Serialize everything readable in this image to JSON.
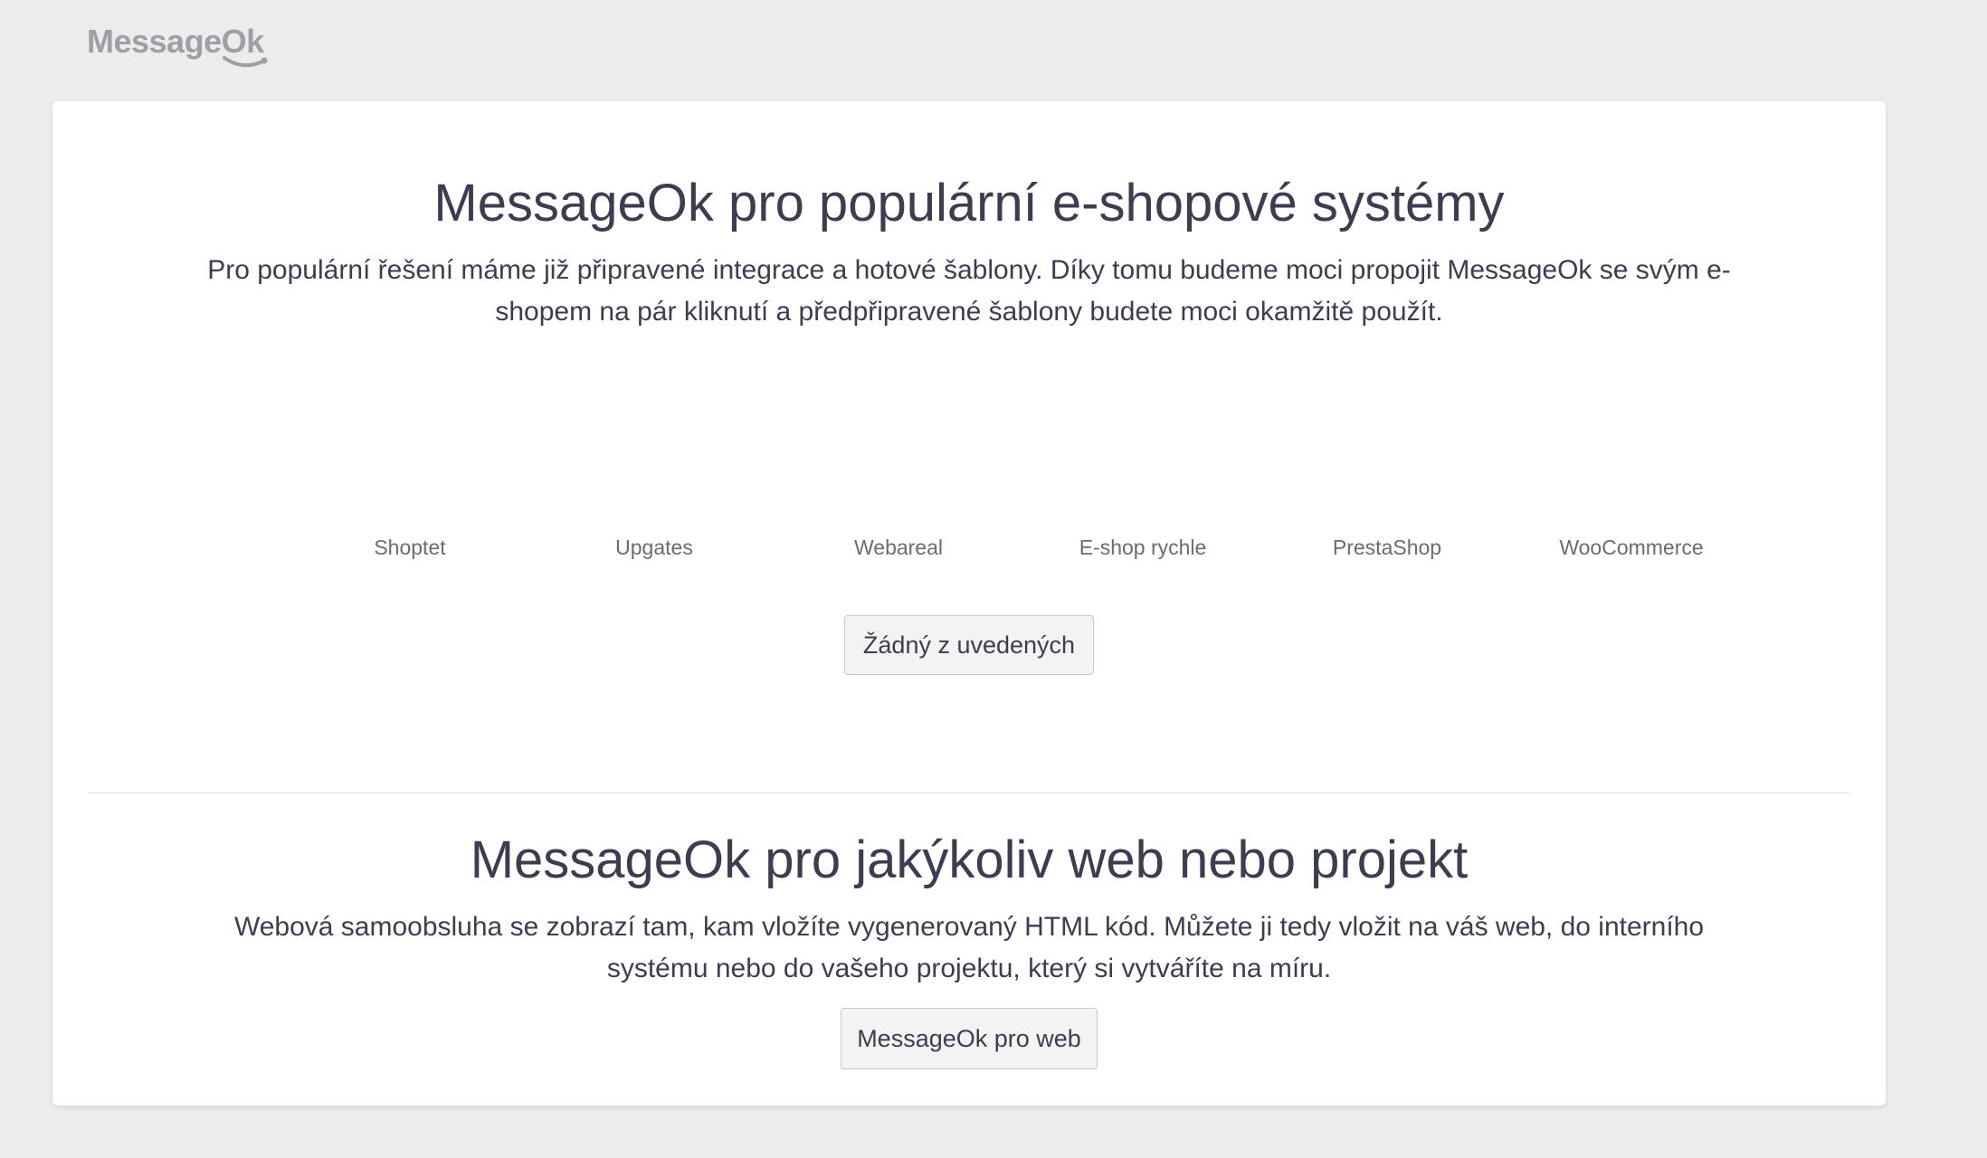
{
  "header": {
    "logo_text": "MessageOk"
  },
  "eshop_section": {
    "title": "MessageOk pro populární e-shopové systémy",
    "description": "Pro populární řešení máme již připravené integrace a hotové šablony. Díky tomu budeme moci propojit MessageOk se svým e-shopem na pár kliknutí a předpřipravené šablony budete moci okamžitě použít.",
    "platforms": [
      "Shoptet",
      "Upgates",
      "Webareal",
      "E-shop rychle",
      "PrestaShop",
      "WooCommerce"
    ],
    "none_button_label": "Žádný z uvedených"
  },
  "web_section": {
    "title": "MessageOk pro jakýkoliv web nebo projekt",
    "description": "Webová samoobsluha se zobrazí tam, kam vložíte vygenerovaný HTML kód. Můžete ji tedy vložit na váš web, do interního systému nebo do vašeho projektu, který si vytváříte na míru.",
    "web_button_label": "MessageOk pro web"
  },
  "colors": {
    "background": "#ececec",
    "card": "#ffffff",
    "text": "#3b3e50",
    "logo": "#9ea0a6"
  }
}
